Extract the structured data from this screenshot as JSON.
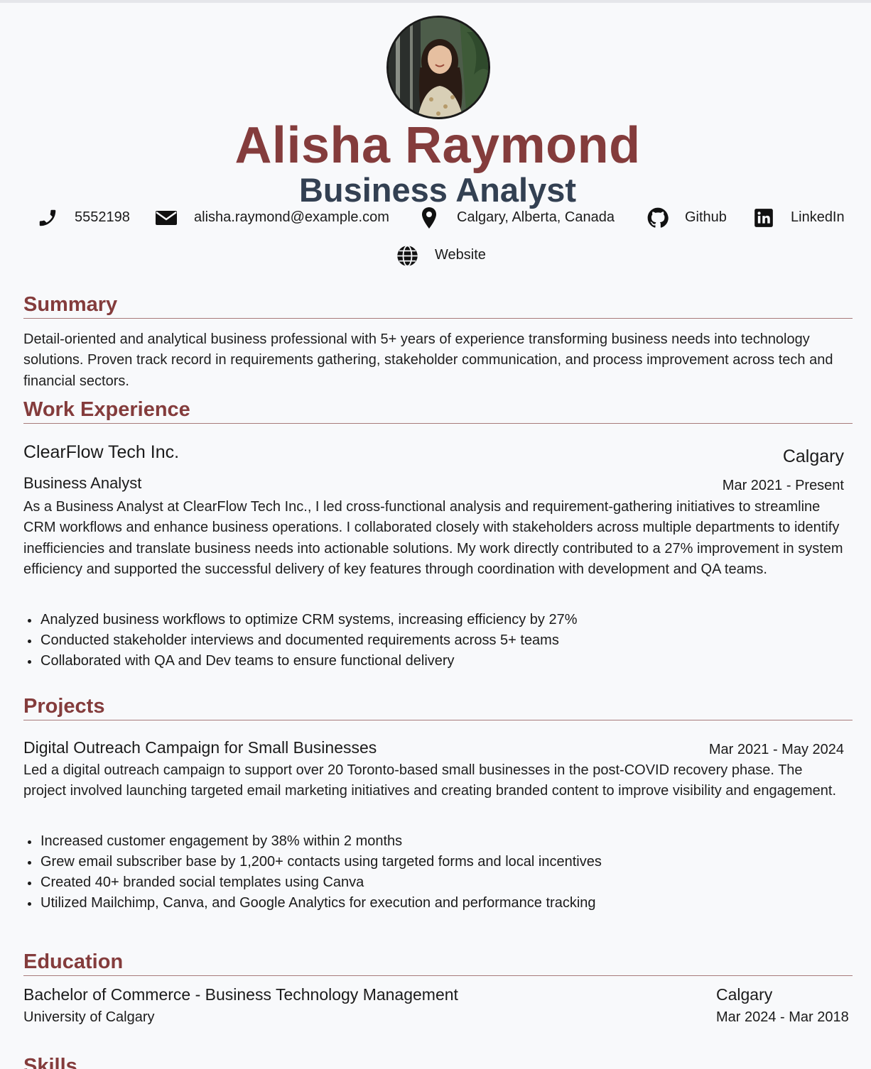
{
  "header": {
    "name": "Alisha Raymond",
    "title": "Business Analyst",
    "photo_alt": "Portrait of Alisha Raymond"
  },
  "contacts": [
    {
      "icon": "phone-icon",
      "text": "5552198"
    },
    {
      "icon": "email-icon",
      "text": "alisha.raymond@example.com"
    },
    {
      "icon": "location-pin-icon",
      "text": "Calgary, Alberta, Canada"
    },
    {
      "icon": "github-icon",
      "text": "Github"
    },
    {
      "icon": "linkedin-icon",
      "text": "LinkedIn"
    },
    {
      "icon": "globe-icon",
      "text": "Website"
    }
  ],
  "summary": {
    "heading": "Summary",
    "text": "Detail-oriented and analytical business professional with 5+ years of experience transforming business needs into technology solutions. Proven track record in requirements gathering, stakeholder communication, and process improvement across tech and financial sectors."
  },
  "work": {
    "heading": "Work Experience",
    "jobs": [
      {
        "company": "ClearFlow Tech Inc.",
        "location": "Calgary",
        "role": "Business Analyst",
        "dates": "Mar 2021 - Present",
        "description": "As a Business Analyst at ClearFlow Tech Inc., I led cross-functional analysis and requirement-gathering initiatives to streamline CRM workflows and enhance business operations. I collaborated closely with stakeholders across multiple departments to identify inefficiencies and translate business needs into actionable solutions. My work directly contributed to a 27% improvement in system efficiency and supported the successful delivery of key features through coordination with development and QA teams.",
        "bullets": [
          "Analyzed business workflows to optimize CRM systems, increasing efficiency by 27%",
          "Conducted stakeholder interviews and documented requirements across 5+ teams",
          "Collaborated with QA and Dev teams to ensure functional delivery"
        ]
      }
    ]
  },
  "projects": {
    "heading": "Projects",
    "items": [
      {
        "name": "Digital Outreach Campaign for Small Businesses",
        "dates": "Mar 2021 - May 2024",
        "description": "Led a digital outreach campaign to support over 20 Toronto-based small businesses in the post-COVID recovery phase. The project involved launching targeted email marketing initiatives and creating branded content to improve visibility and engagement.",
        "bullets": [
          "Increased customer engagement by 38% within 2 months",
          "Grew email subscriber base by 1,200+ contacts using targeted forms and local incentives",
          "Created 40+ branded social templates using Canva",
          "Utilized Mailchimp, Canva, and Google Analytics for execution and performance tracking"
        ]
      }
    ]
  },
  "education": {
    "heading": "Education",
    "items": [
      {
        "degree": "Bachelor of Commerce - Business Technology Management",
        "school": "University of Calgary",
        "location": "Calgary",
        "dates": "Mar 2024 - Mar 2018"
      }
    ]
  },
  "skills": {
    "heading": "Skills"
  },
  "colors": {
    "accent": "#843c3c",
    "title": "#334052",
    "background": "#f8f9fb"
  }
}
